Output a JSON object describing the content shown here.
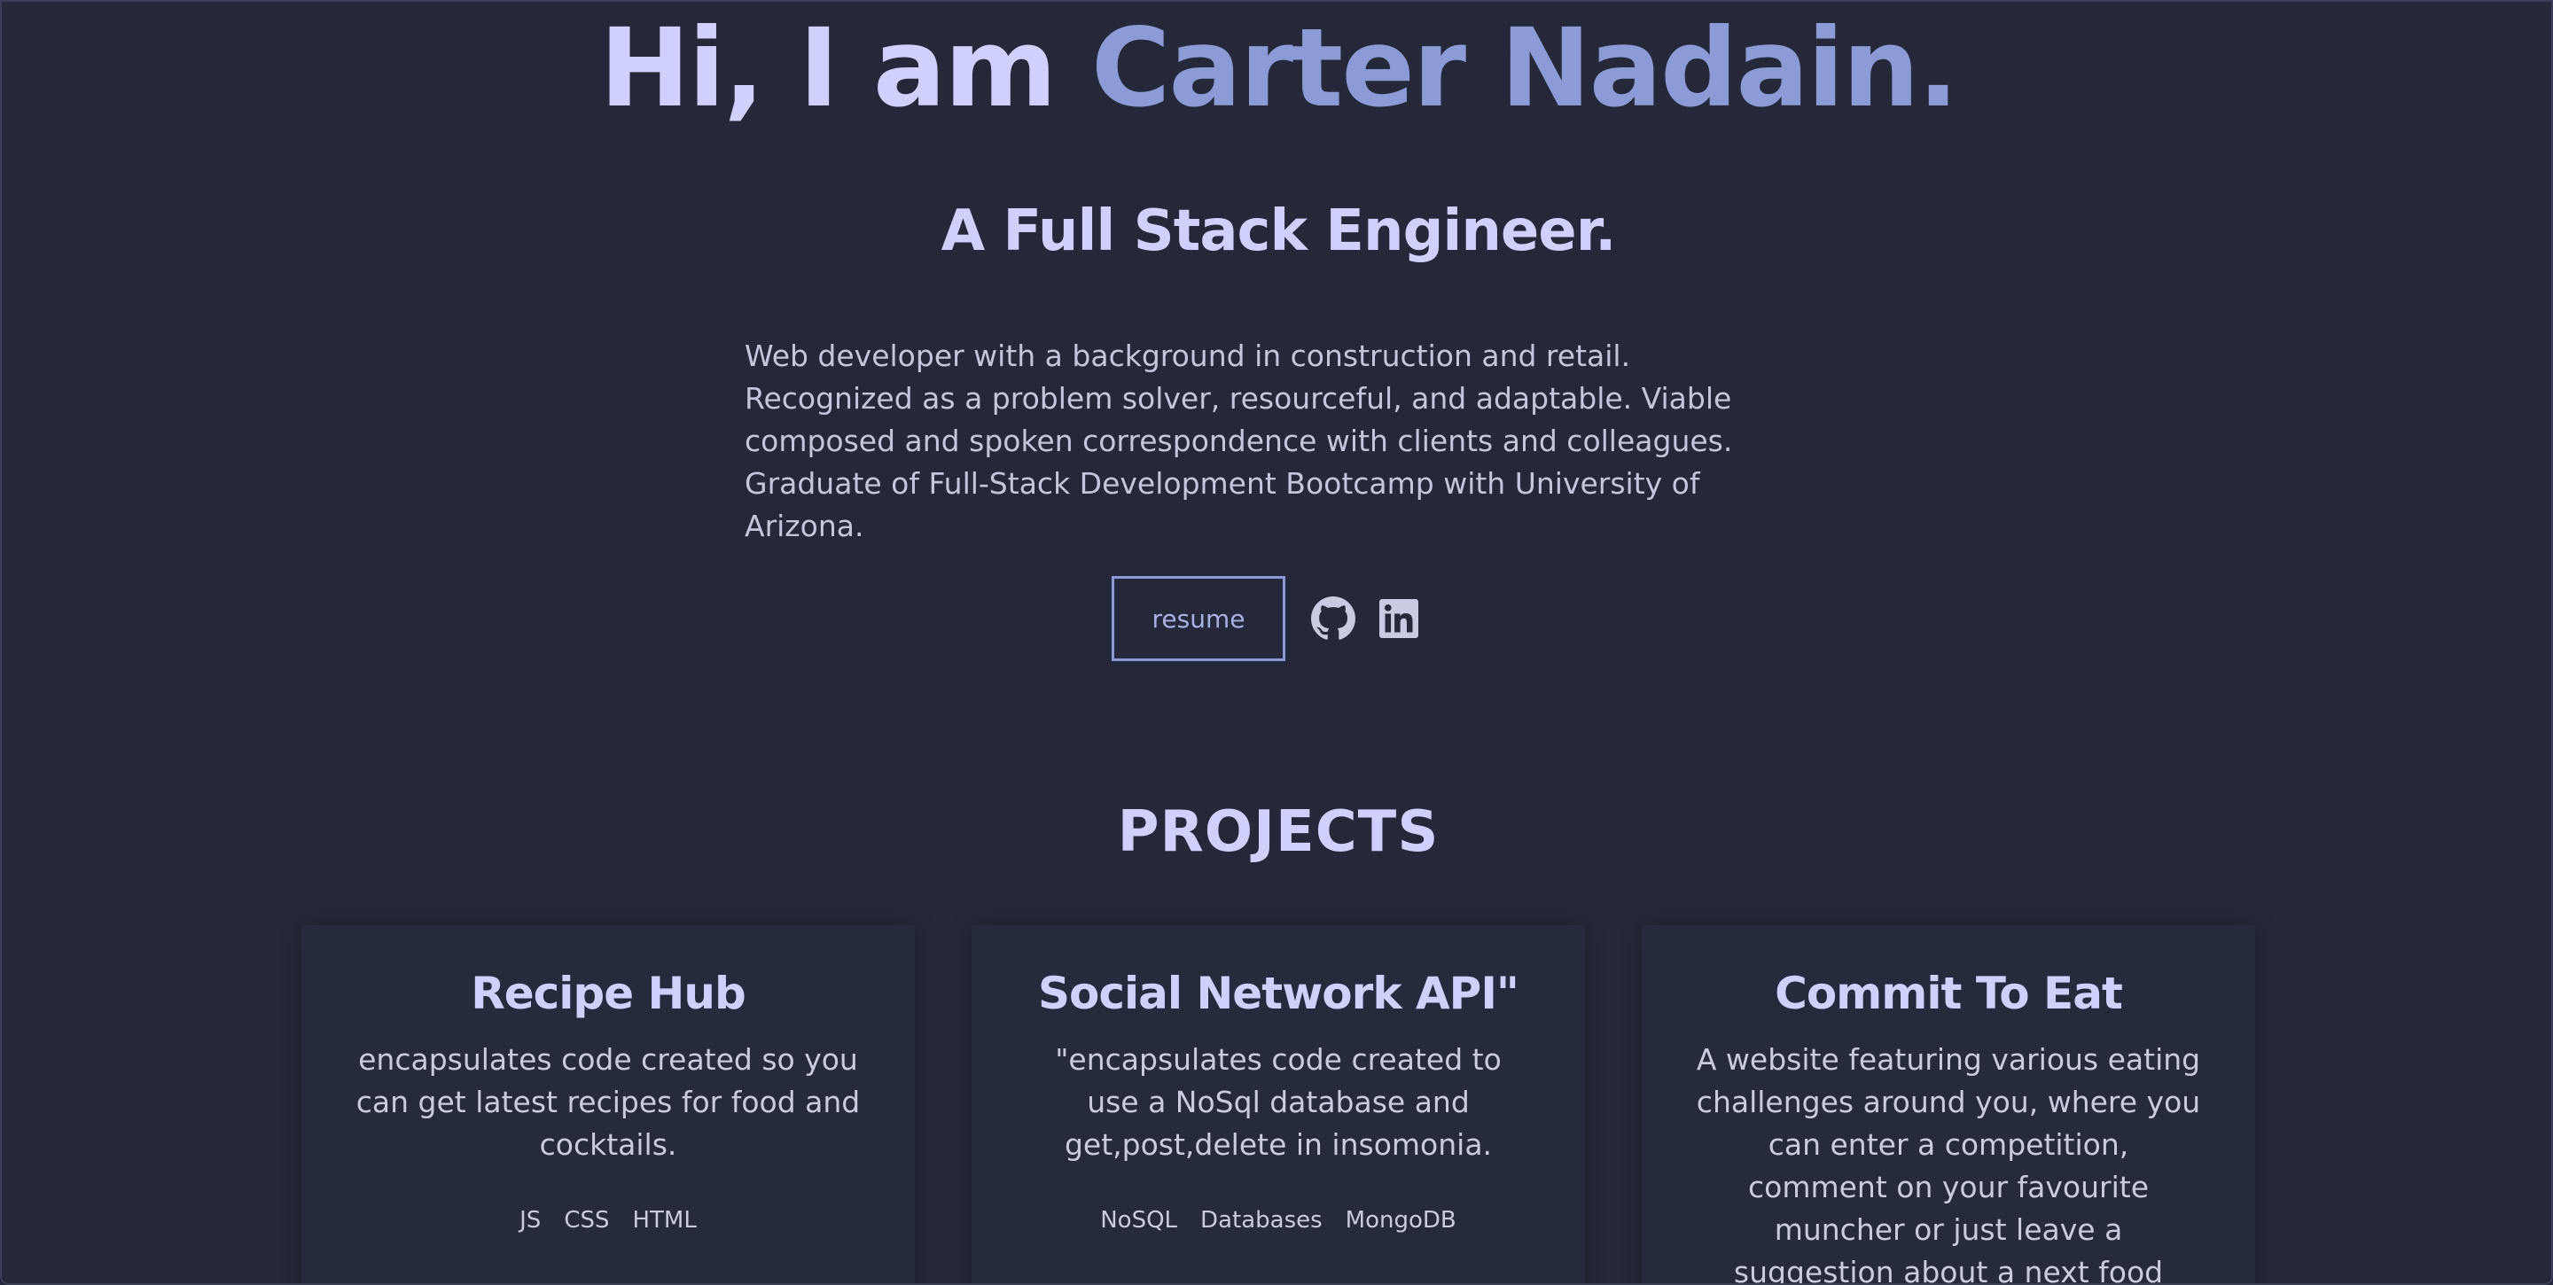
{
  "hero": {
    "greeting": "Hi, I am ",
    "name": "Carter Nadain.",
    "subtitle": "A Full Stack Engineer.",
    "bio": "Web developer with a background in construction and retail. Recognized as a problem solver, resourceful, and adaptable. Viable composed and spoken correspondence with clients and colleagues. Graduate of Full-Stack Development Bootcamp with University of Arizona."
  },
  "actions": {
    "resume_label": "resume",
    "github_icon": "github-icon",
    "linkedin_icon": "linkedin-icon"
  },
  "projects": {
    "heading": "PROJECTS",
    "items": [
      {
        "title": "Recipe Hub",
        "description": "encapsulates code created so you can get latest recipes for food and cocktails.",
        "tags": [
          "JS",
          "CSS",
          "HTML"
        ]
      },
      {
        "title": "Social Network API\"",
        "description": "\"encapsulates code created to use a NoSql database and get,post,delete in insomonia.",
        "tags": [
          "NoSQL",
          "Databases",
          "MongoDB"
        ]
      },
      {
        "title": "Commit To Eat",
        "description": "A website featuring various eating challenges around you, where you can enter a competition, comment on your favourite muncher or just leave a suggestion about a next food event.",
        "tags": []
      }
    ]
  },
  "colors": {
    "background": "#242839",
    "accent": "#8c9bd6",
    "heading": "#cfd0fb",
    "text": "#c9cbe0"
  }
}
